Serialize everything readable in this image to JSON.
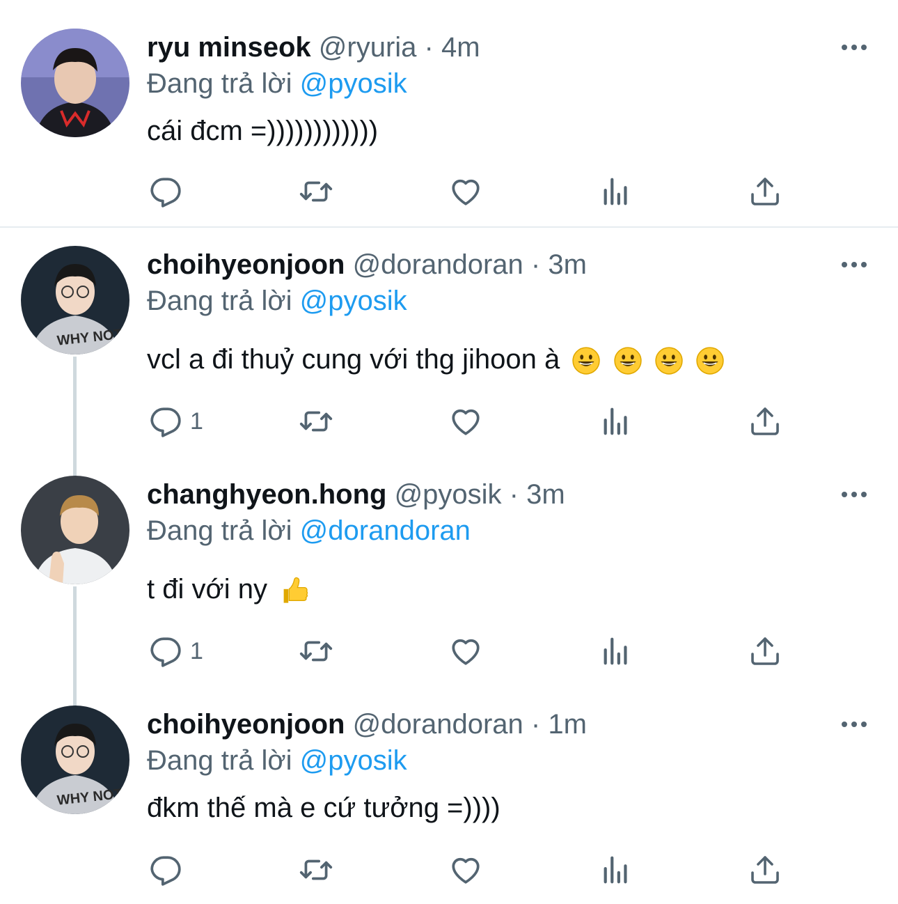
{
  "tweets": [
    {
      "name": "ryu minseok",
      "handle": "@ryuria",
      "separator": "·",
      "time": "4m",
      "replying_prefix": "Đang trả lời",
      "replying_to": "@pyosik",
      "text": "cái đcm =))))))))))))",
      "reply_count": "",
      "avatar_icon": "avatar-ryu-minseok"
    },
    {
      "name": "choihyeonjoon",
      "handle": "@dorandoran",
      "separator": "·",
      "time": "3m",
      "replying_prefix": "Đang trả lời",
      "replying_to": "@pyosik",
      "text": "vcl a đi thuỷ cung với thg jihoon à",
      "emojis": [
        "grinning-face",
        "grinning-face",
        "grinning-face",
        "grinning-face"
      ],
      "reply_count": "1",
      "avatar_icon": "avatar-choihyeonjoon"
    },
    {
      "name": "changhyeon.hong",
      "handle": "@pyosik",
      "separator": "·",
      "time": "3m",
      "replying_prefix": "Đang trả lời",
      "replying_to": "@dorandoran",
      "text": "t đi với ny",
      "emojis": [
        "thumbs-up"
      ],
      "reply_count": "1",
      "avatar_icon": "avatar-changhyeon-hong"
    },
    {
      "name": "choihyeonjoon",
      "handle": "@dorandoran",
      "separator": "·",
      "time": "1m",
      "replying_prefix": "Đang trả lời",
      "replying_to": "@pyosik",
      "text": "đkm thế mà e cứ tưởng =))))",
      "reply_count": "",
      "avatar_icon": "avatar-choihyeonjoon"
    }
  ],
  "colors": {
    "text_primary": "#0f1419",
    "text_secondary": "#536471",
    "mention": "#1d9bf0",
    "thread_line": "#cfd9de",
    "divider": "#e6ecf0"
  },
  "action_icons": [
    "reply-icon",
    "retweet-icon",
    "like-icon",
    "views-icon",
    "share-icon"
  ]
}
